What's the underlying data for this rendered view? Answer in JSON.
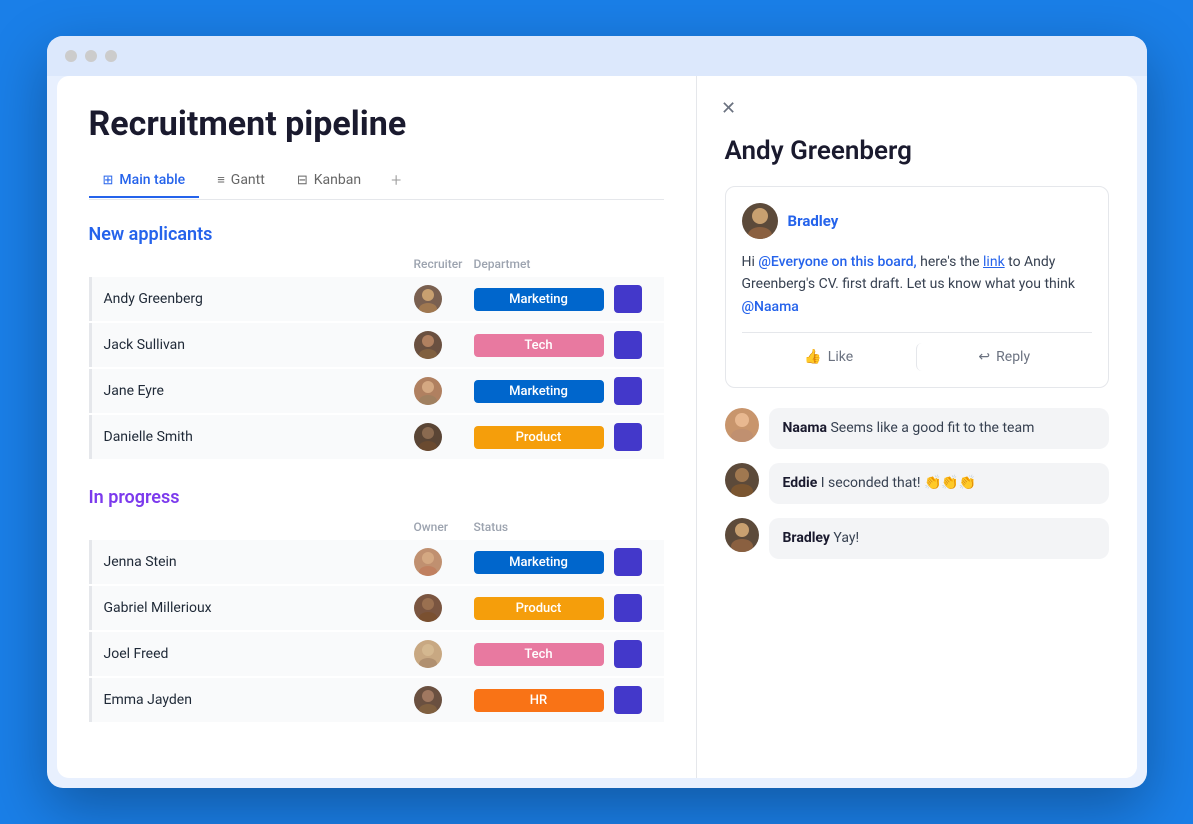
{
  "window": {
    "title": "Recruitment pipeline"
  },
  "header": {
    "title": "Recruitment pipeline",
    "tabs": [
      {
        "id": "main-table",
        "label": "Main table",
        "icon": "⊞",
        "active": true
      },
      {
        "id": "gantt",
        "label": "Gantt",
        "icon": "≡",
        "active": false
      },
      {
        "id": "kanban",
        "label": "Kanban",
        "icon": "⊟",
        "active": false
      }
    ],
    "add_tab_label": "+"
  },
  "sections": [
    {
      "id": "new-applicants",
      "title": "New applicants",
      "color": "blue",
      "col1": "Recruiter",
      "col2": "Departmet",
      "rows": [
        {
          "name": "Andy Greenberg",
          "dept": "Marketing",
          "dept_class": "dept-marketing",
          "avatar": "andy"
        },
        {
          "name": "Jack Sullivan",
          "dept": "Tech",
          "dept_class": "dept-tech",
          "avatar": "jack"
        },
        {
          "name": "Jane Eyre",
          "dept": "Marketing",
          "dept_class": "dept-marketing",
          "avatar": "jane"
        },
        {
          "name": "Danielle Smith",
          "dept": "Product",
          "dept_class": "dept-product",
          "avatar": "danielle"
        }
      ]
    },
    {
      "id": "in-progress",
      "title": "In progress",
      "color": "purple",
      "col1": "Owner",
      "col2": "Status",
      "rows": [
        {
          "name": "Jenna Stein",
          "dept": "Marketing",
          "dept_class": "dept-marketing",
          "avatar": "jenna"
        },
        {
          "name": "Gabriel Millerioux",
          "dept": "Product",
          "dept_class": "dept-product",
          "avatar": "gabriel"
        },
        {
          "name": "Joel Freed",
          "dept": "Tech",
          "dept_class": "dept-tech",
          "avatar": "joel"
        },
        {
          "name": "Emma Jayden",
          "dept": "HR",
          "dept_class": "dept-hr",
          "avatar": "emma"
        }
      ]
    }
  ],
  "panel": {
    "person_name": "Andy Greenberg",
    "close_icon": "✕",
    "comment": {
      "author": "Bradley",
      "author_color": "#2563eb",
      "text_prefix": "Hi ",
      "mention_everyone": "@Everyone on this board,",
      "text_middle": " here's the ",
      "link_text": "link",
      "text_after": " to Andy Greenberg's CV. first draft. Let us know what you think ",
      "mention_naama": "@Naama",
      "like_label": "Like",
      "reply_label": "Reply"
    },
    "replies": [
      {
        "id": "reply-naama",
        "author": "Naama",
        "text": " Seems like a good fit to the team",
        "avatar": "naama"
      },
      {
        "id": "reply-eddie",
        "author": "Eddie",
        "text": " I seconded that! 👏👏👏",
        "avatar": "eddie"
      },
      {
        "id": "reply-bradley",
        "author": "Bradley",
        "text": " Yay!",
        "avatar": "bradley"
      }
    ]
  }
}
